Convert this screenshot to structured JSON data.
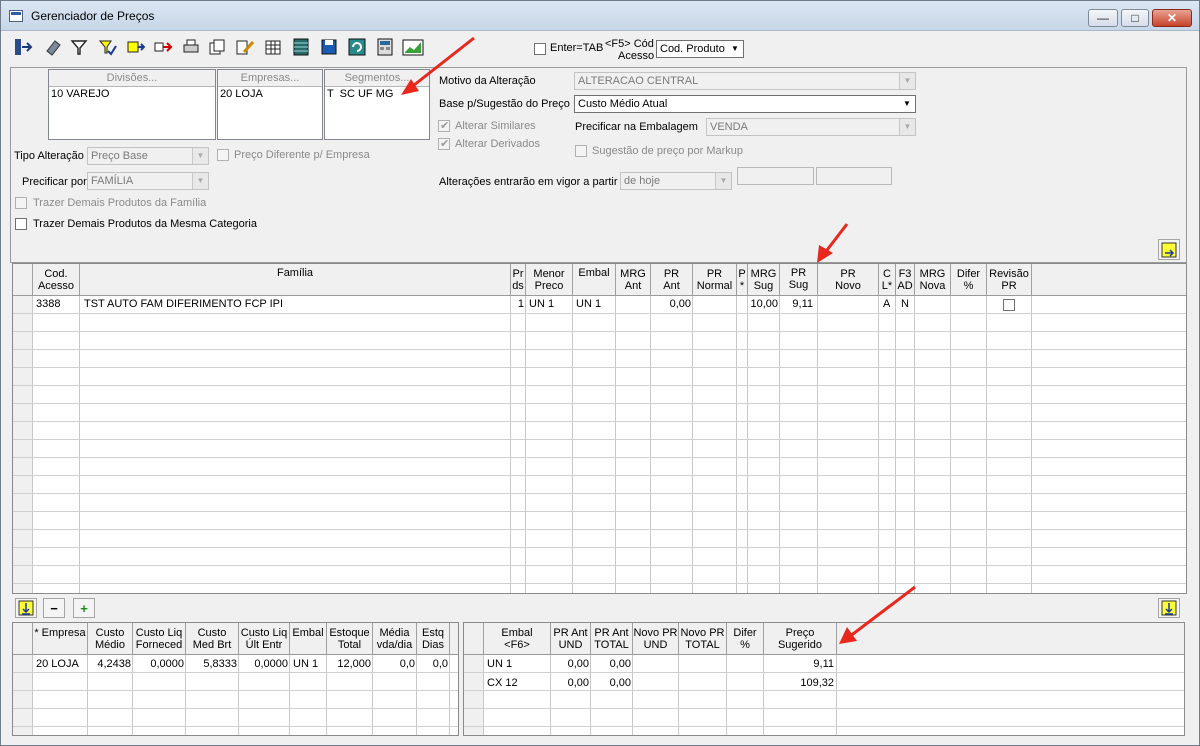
{
  "window": {
    "title": "Gerenciador de Preços",
    "min": "—",
    "max": "□",
    "close": "✕"
  },
  "toolbar": {
    "icons": [
      "exit-icon",
      "eraser-icon",
      "filter-icon",
      "filter-check-icon",
      "add-row-icon",
      "move-right-icon",
      "print-icon",
      "copy-icon",
      "edit-icon",
      "grid-icon",
      "table-icon",
      "save-icon",
      "refresh-icon",
      "calc-icon",
      "chart-icon"
    ],
    "enter_tab_label": "Enter=TAB",
    "f5_label_1": "<F5> Cód",
    "f5_label_2": "Acesso",
    "cod_select": "Cod. Produto"
  },
  "filters": {
    "divisoes_header": "Divisões...",
    "empresas_header": "Empresas...",
    "segmentos_header": "Segmentos...",
    "divisoes_value": "10 VAREJO",
    "empresas_value": "20 LOJA",
    "segmentos_value": "T  SC UF MG",
    "tipo_alteracao_label": "Tipo Alteração",
    "tipo_alteracao_value": "Preço Base",
    "preco_diferente_label": "Preço Diferente p/ Empresa",
    "precificar_por_label": "Precificar por",
    "precificar_por_value": "FAMÍLIA",
    "trazer_familia_label": "Trazer Demais Produtos da Família",
    "trazer_categoria_label": "Trazer Demais Produtos da Mesma Categoria",
    "motivo_label": "Motivo da Alteração",
    "motivo_value": "ALTERACAO CENTRAL",
    "base_label": "Base p/Sugestão do Preço",
    "base_value": "Custo Médio Atual",
    "alterar_similares_label": "Alterar Similares",
    "alterar_derivados_label": "Alterar Derivados",
    "precificar_embalagem_label": "Precificar na Embalagem",
    "precificar_embalagem_value": "VENDA",
    "sugestao_markup_label": "Sugestão de preço por Markup",
    "vigor_label": "Alterações entrarão em vigor a partir",
    "vigor_value": "de hoje"
  },
  "main_grid": {
    "headers": [
      "Cod.\nAcesso",
      "Família",
      "Pr\nds",
      "Menor\nPreco",
      "Embal",
      "MRG\nAnt",
      "PR\nAnt",
      "PR\nNormal",
      "P\n*",
      "MRG\nSug",
      "PR Sug",
      "PR\nNovo",
      "C\nL*",
      "F3\nAD",
      "MRG\nNova",
      "Difer\n%",
      "Revisão\nPR"
    ],
    "row": {
      "cod": "3388",
      "familia": "TST AUTO FAM DIFERIMENTO FCP IPI",
      "prds": "1",
      "menor": "UN 1",
      "embal": "UN 1",
      "pr_ant": "0,00",
      "mrg_sug": "10,00",
      "pr_sug": "9,11",
      "cl": "A",
      "f3ad": "N"
    },
    "minus": "−",
    "plus": "+"
  },
  "empresa_grid": {
    "headers": [
      "* Empresa",
      "Custo\nMédio",
      "Custo Liq\nForneced",
      "Custo\nMed Brt",
      "Custo Liq\nÚlt Entr",
      "Embal",
      "Estoque\nTotal",
      "Média\nvda/dia",
      "Estq\nDias"
    ],
    "row": [
      "20 LOJA",
      "4,2438",
      "0,0000",
      "5,8333",
      "0,0000",
      "UN 1",
      "12,000",
      "0,0",
      "0,0"
    ]
  },
  "embal_grid": {
    "headers": [
      "Embal\n<F6>",
      "PR Ant\nUND",
      "PR Ant\nTOTAL",
      "Novo PR\nUND",
      "Novo PR\nTOTAL",
      "Difer\n%",
      "Preço\nSugerido"
    ],
    "rows": [
      [
        "UN 1",
        "0,00",
        "0,00",
        "",
        "",
        "",
        "9,11"
      ],
      [
        "CX 12",
        "0,00",
        "0,00",
        "",
        "",
        "",
        "109,32"
      ]
    ]
  },
  "colors": {
    "annotation_arrow": "#e8281c"
  }
}
